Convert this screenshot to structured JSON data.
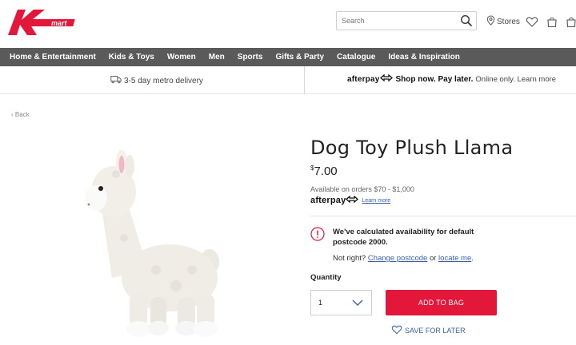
{
  "header": {
    "logo_text": "mart",
    "search": {
      "placeholder": "Search"
    },
    "stores_label": "Stores"
  },
  "nav": {
    "items": [
      "Home & Entertainment",
      "Kids & Toys",
      "Women",
      "Men",
      "Sports",
      "Gifts & Party",
      "Catalogue",
      "Ideas & Inspiration"
    ]
  },
  "promo": {
    "delivery": "3-5 day metro delivery",
    "afterpay_brand": "afterpay",
    "afterpay_bold": "Shop now. Pay later.",
    "afterpay_light": "Online only. Learn more"
  },
  "back_label": "Back",
  "product": {
    "title": "Dog Toy Plush Llama",
    "price_currency": "$",
    "price_value": "7.00",
    "availability": "Available on orders $70 - $1,000",
    "afterpay_brand": "afterpay",
    "afterpay_learn": "Learn more"
  },
  "notice": {
    "text": "We've calculated availability for default postcode 2000.",
    "not_right": "Not right?",
    "change_postcode": "Change postcode",
    "or": "or",
    "locate_me": "locate me",
    "period": "."
  },
  "quantity": {
    "label": "Quantity",
    "value": "1"
  },
  "actions": {
    "add_to_bag": "ADD TO BAG",
    "save_for_later": "SAVE FOR LATER"
  },
  "colors": {
    "brand_red": "#e2173a",
    "nav_bg": "#5a5a5a",
    "link_blue": "#3a5fa8"
  }
}
